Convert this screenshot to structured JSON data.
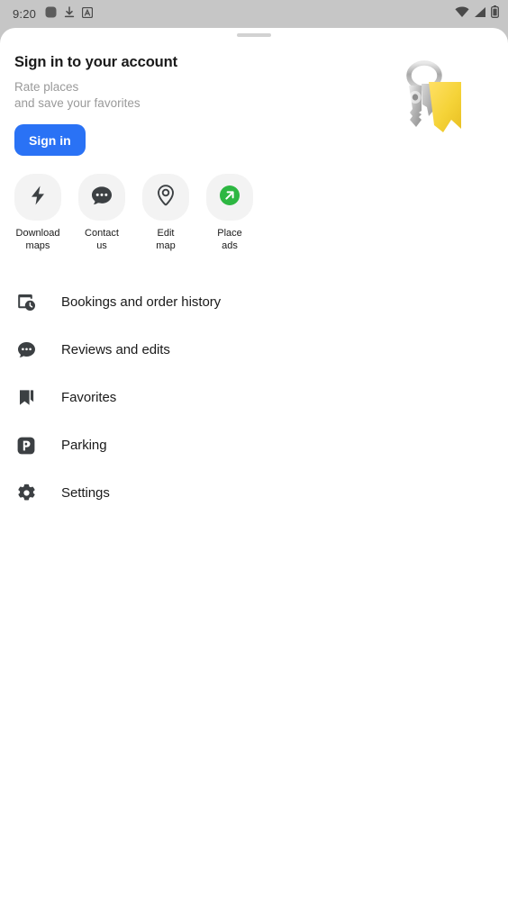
{
  "statusbar": {
    "time": "9:20",
    "left_icons": [
      "rounded-square-icon",
      "download-icon",
      "boxed-a-icon"
    ],
    "right_icons": [
      "wifi-icon",
      "cellular-signal-icon",
      "battery-icon"
    ],
    "background_color": "#c6c6c6"
  },
  "sheet": {
    "drag_handle": "drag-handle",
    "background_color": "#ffffff"
  },
  "header": {
    "title": "Sign in to your account",
    "subtitle": "Rate places\nand save your favorites",
    "subtitle_line1": "Rate places",
    "subtitle_line2": "and save your favorites",
    "signin_label": "Sign in",
    "signin_color": "#2a72f5",
    "illustration": "keys-with-yellow-tag-illustration"
  },
  "quick_actions": [
    {
      "label": "Download\nmaps",
      "icon": "lightning-bolt-icon"
    },
    {
      "label": "Contact us",
      "icon": "chat-bubble-icon"
    },
    {
      "label": "Edit\nmap",
      "icon": "map-pin-icon"
    },
    {
      "label": "Place\nads",
      "icon": "green-arrow-circle-icon",
      "accent_color": "#2db742"
    }
  ],
  "menu": [
    {
      "label": "Bookings and order history",
      "icon": "calendar-clock-icon"
    },
    {
      "label": "Reviews and edits",
      "icon": "chat-bubble-icon"
    },
    {
      "label": "Favorites",
      "icon": "bookmark-icon"
    },
    {
      "label": "Parking",
      "icon": "parking-p-icon"
    },
    {
      "label": "Settings",
      "icon": "gear-icon"
    }
  ]
}
